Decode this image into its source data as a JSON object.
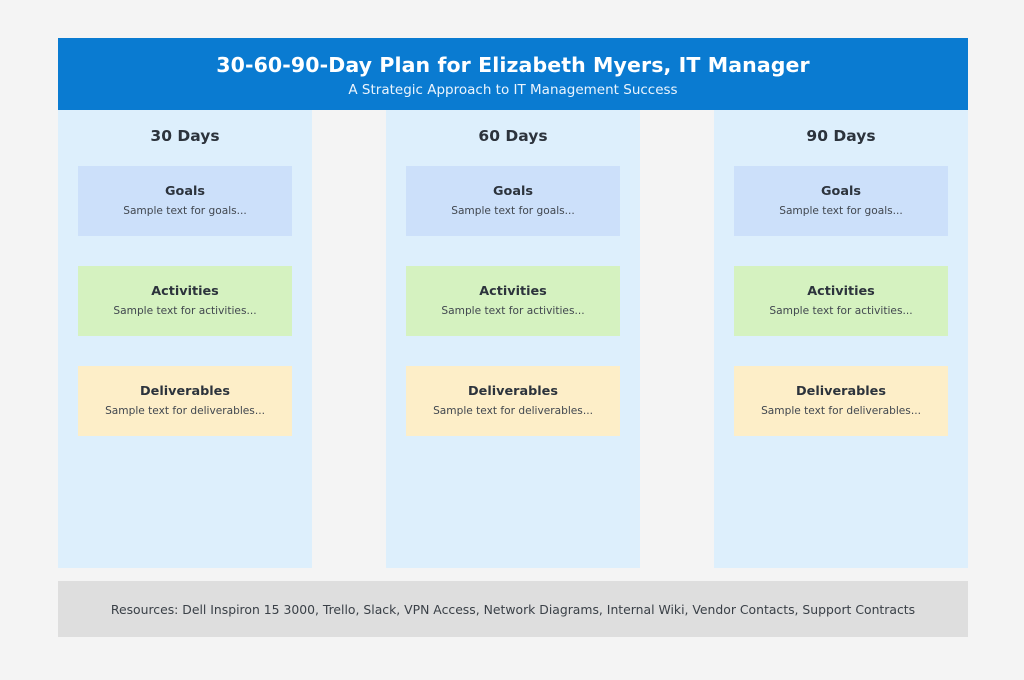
{
  "header": {
    "title": "30-60-90-Day Plan for Elizabeth Myers, IT Manager",
    "subtitle": "A Strategic Approach to IT Management Success",
    "background_color": "#0a7bd1"
  },
  "columns": [
    {
      "title": "30 Days",
      "background_color": "#ddeffc",
      "cards": [
        {
          "title": "Goals",
          "text": "Sample text for goals...",
          "color": "#cce0fa"
        },
        {
          "title": "Activities",
          "text": "Sample text for activities...",
          "color": "#d5f2c0"
        },
        {
          "title": "Deliverables",
          "text": "Sample text for deliverables...",
          "color": "#fdeec8"
        }
      ]
    },
    {
      "title": "60 Days",
      "background_color": "#ddeffc",
      "cards": [
        {
          "title": "Goals",
          "text": "Sample text for goals...",
          "color": "#cce0fa"
        },
        {
          "title": "Activities",
          "text": "Sample text for activities...",
          "color": "#d5f2c0"
        },
        {
          "title": "Deliverables",
          "text": "Sample text for deliverables...",
          "color": "#fdeec8"
        }
      ]
    },
    {
      "title": "90 Days",
      "background_color": "#ddeffc",
      "cards": [
        {
          "title": "Goals",
          "text": "Sample text for goals...",
          "color": "#cce0fa"
        },
        {
          "title": "Activities",
          "text": "Sample text for activities...",
          "color": "#d5f2c0"
        },
        {
          "title": "Deliverables",
          "text": "Sample text for deliverables...",
          "color": "#fdeec8"
        }
      ]
    }
  ],
  "footer": {
    "resources_text": "Resources: Dell Inspiron 15 3000, Trello, Slack, VPN Access, Network Diagrams, Internal Wiki, Vendor Contacts, Support Contracts",
    "background_color": "#dedede"
  }
}
